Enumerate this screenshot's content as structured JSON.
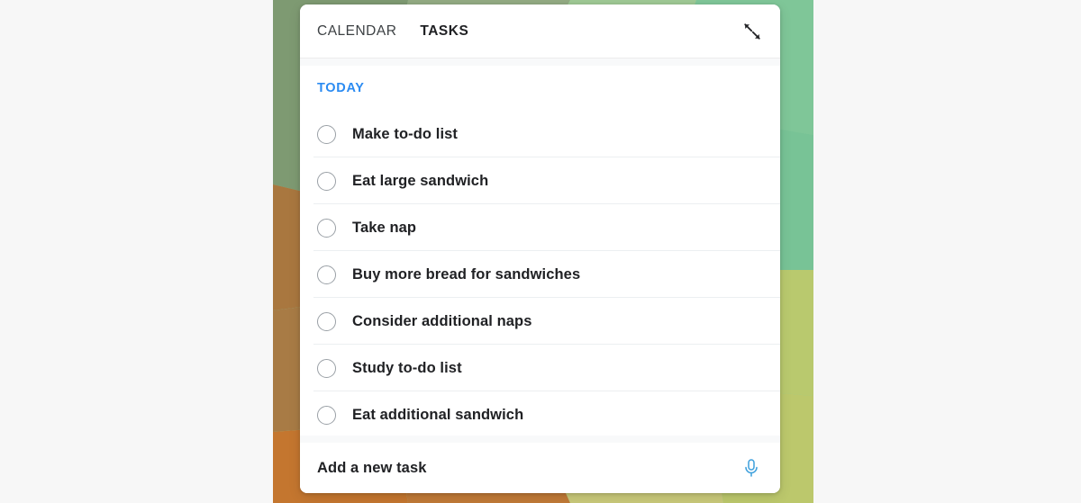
{
  "theme": {
    "page_background": "#f7f7f7",
    "card_background": "#ffffff",
    "accent_blue": "#2b8bf2",
    "mic_blue": "#3c9fdc",
    "text_primary": "#202124",
    "divider": "#eceff1",
    "checkbox_border": "#9aa0a6",
    "wallpaper_colors": [
      "#7e9a72",
      "#9ab98f",
      "#79c095",
      "#8ecfa2",
      "#a9773f",
      "#b4834c",
      "#c4762f",
      "#c0cf77",
      "#b9c96e",
      "#7fbf8c"
    ]
  },
  "header": {
    "tabs": [
      {
        "label": "CALENDAR",
        "active": false
      },
      {
        "label": "TASKS",
        "active": true
      }
    ],
    "expand_icon": "expand-diagonal-icon"
  },
  "sections": [
    {
      "label": "TODAY",
      "tasks": [
        {
          "title": "Make to-do list",
          "checked": false
        },
        {
          "title": "Eat large sandwich",
          "checked": false
        },
        {
          "title": "Take nap",
          "checked": false
        },
        {
          "title": "Buy more bread for sandwiches",
          "checked": false
        },
        {
          "title": "Consider additional naps",
          "checked": false
        },
        {
          "title": "Study to-do list",
          "checked": false
        },
        {
          "title": "Eat additional sandwich",
          "checked": false
        }
      ]
    }
  ],
  "footer": {
    "add_task_label": "Add a new task",
    "mic_icon": "microphone-icon"
  }
}
